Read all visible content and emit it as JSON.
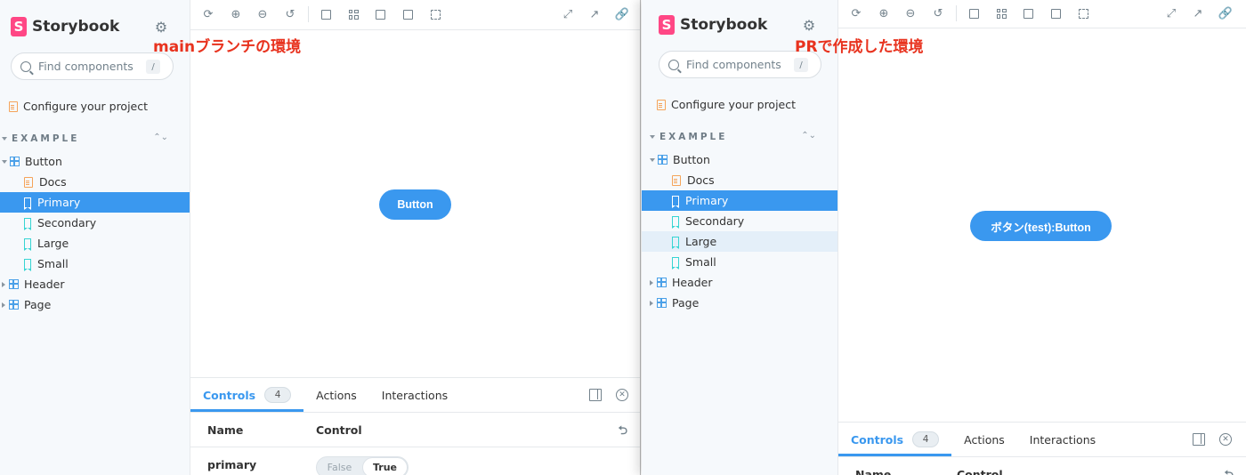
{
  "colors": {
    "accent": "#3a98ef",
    "brand": "#ff4785",
    "annotation": "#e8321e"
  },
  "left": {
    "brand": {
      "logo_letter": "S",
      "name": "Storybook"
    },
    "annotation": "mainブランチの環境",
    "search": {
      "placeholder": "Find components",
      "shortcut": "/"
    },
    "configure_label": "Configure your project",
    "section": {
      "label": "EXAMPLE"
    },
    "tree": {
      "button": "Button",
      "docs": "Docs",
      "primary": "Primary",
      "secondary": "Secondary",
      "large": "Large",
      "small": "Small",
      "header": "Header",
      "page": "Page"
    },
    "preview_button_label": "Button",
    "addons": {
      "tabs": {
        "controls": "Controls",
        "controls_count": "4",
        "actions": "Actions",
        "interactions": "Interactions"
      },
      "columns": {
        "name": "Name",
        "control": "Control"
      },
      "row": {
        "name": "primary",
        "false_label": "False",
        "true_label": "True"
      }
    }
  },
  "right": {
    "brand": {
      "logo_letter": "S",
      "name": "Storybook"
    },
    "annotation": "PRで作成した環境",
    "search": {
      "placeholder": "Find components",
      "shortcut": "/"
    },
    "configure_label": "Configure your project",
    "section": {
      "label": "EXAMPLE"
    },
    "tree": {
      "button": "Button",
      "docs": "Docs",
      "primary": "Primary",
      "secondary": "Secondary",
      "large": "Large",
      "small": "Small",
      "header": "Header",
      "page": "Page"
    },
    "preview_button_label": "ボタン(test):Button",
    "addons": {
      "tabs": {
        "controls": "Controls",
        "controls_count": "4",
        "actions": "Actions",
        "interactions": "Interactions"
      },
      "columns": {
        "name": "Name",
        "control": "Control"
      }
    }
  }
}
